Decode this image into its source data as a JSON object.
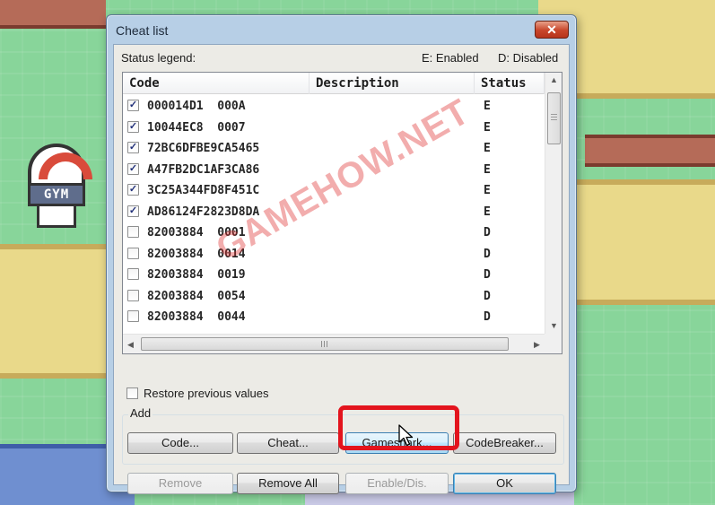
{
  "background": {
    "gym_sign_text": "GYM"
  },
  "dialog": {
    "title": "Cheat list",
    "close_label": "✕",
    "status_legend": {
      "label": "Status legend:",
      "enabled": "E: Enabled",
      "disabled": "D: Disabled"
    },
    "list": {
      "columns": [
        "Code",
        "Description",
        "Status"
      ],
      "rows": [
        {
          "code": "000014D1  000A",
          "description": "",
          "status": "E",
          "checked": true
        },
        {
          "code": "10044EC8  0007",
          "description": "",
          "status": "E",
          "checked": true
        },
        {
          "code": "72BC6DFBE9CA5465",
          "description": "",
          "status": "E",
          "checked": true
        },
        {
          "code": "A47FB2DC1AF3CA86",
          "description": "",
          "status": "E",
          "checked": true
        },
        {
          "code": "3C25A344FD8F451C",
          "description": "",
          "status": "E",
          "checked": true
        },
        {
          "code": "AD86124F2823D8DA",
          "description": "",
          "status": "E",
          "checked": true
        },
        {
          "code": "82003884  0001",
          "description": "",
          "status": "D",
          "checked": false
        },
        {
          "code": "82003884  0014",
          "description": "",
          "status": "D",
          "checked": false
        },
        {
          "code": "82003884  0019",
          "description": "",
          "status": "D",
          "checked": false
        },
        {
          "code": "82003884  0054",
          "description": "",
          "status": "D",
          "checked": false
        },
        {
          "code": "82003884  0044",
          "description": "",
          "status": "D",
          "checked": false
        }
      ],
      "check_glyph": "✓",
      "scroll_up": "▲",
      "scroll_down": "▼",
      "scroll_left": "◀",
      "scroll_right": "▶"
    },
    "restore_label": "Restore previous values",
    "add_group": {
      "label": "Add",
      "buttons": {
        "code": "Code...",
        "cheat": "Cheat...",
        "gameshark": "Gameshark...",
        "codebreaker": "CodeBreaker..."
      }
    },
    "bottom_buttons": {
      "remove": "Remove",
      "remove_all": "Remove All",
      "enable_dis": "Enable/Dis.",
      "ok": "OK"
    }
  },
  "watermark": "GAMEHOW.NET",
  "colors": {
    "highlight": "#e3141d",
    "dialog_frame": "#b7cfe6",
    "watermark": "#dc2828"
  }
}
